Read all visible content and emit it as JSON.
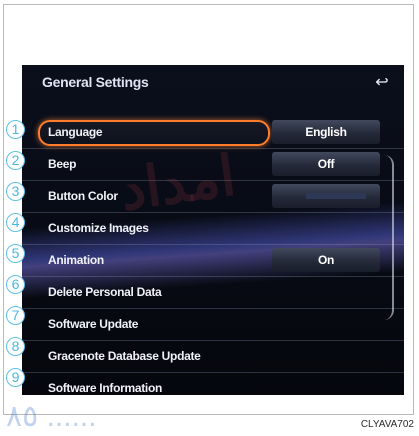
{
  "header": {
    "title": "General Settings",
    "back_icon": "↩"
  },
  "items": [
    {
      "number": "1",
      "label": "Language",
      "value": "English"
    },
    {
      "number": "2",
      "label": "Beep",
      "value": "Off"
    },
    {
      "number": "3",
      "label": "Button Color",
      "value": ""
    },
    {
      "number": "4",
      "label": "Customize Images",
      "value": ""
    },
    {
      "number": "5",
      "label": "Animation",
      "value": "On"
    },
    {
      "number": "6",
      "label": "Delete Personal Data",
      "value": ""
    },
    {
      "number": "7",
      "label": "Software Update",
      "value": ""
    },
    {
      "number": "8",
      "label": "Gracenote Database Update",
      "value": ""
    },
    {
      "number": "9",
      "label": "Software Information",
      "value": ""
    }
  ],
  "footer": {
    "code": "CLYAVA702"
  },
  "colors": {
    "selected_outline": "#ff7d2a",
    "callout_blue": "#5dc1e8"
  }
}
